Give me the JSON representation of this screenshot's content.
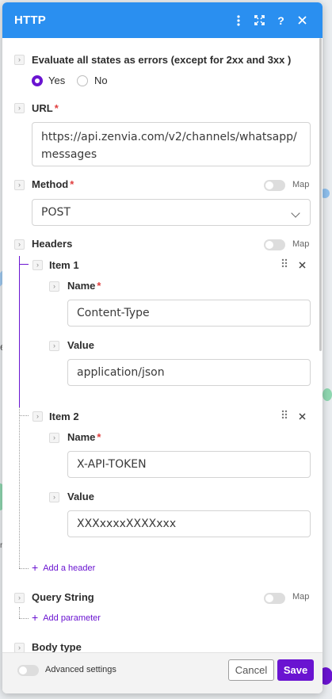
{
  "header": {
    "title": "HTTP"
  },
  "evaluate": {
    "label": "Evaluate all states as errors (except for 2xx and 3xx )",
    "yes_label": "Yes",
    "no_label": "No",
    "selected": "Yes"
  },
  "url": {
    "label": "URL",
    "required_mark": "*",
    "value": "https://api.zenvia.com/v2/channels/whatsapp/\nmessages"
  },
  "method": {
    "label": "Method",
    "required_mark": "*",
    "value": "POST",
    "map_label": "Map"
  },
  "headers": {
    "label": "Headers",
    "map_label": "Map",
    "items": [
      {
        "title": "Item 1",
        "name_label": "Name",
        "name_value": "Content-Type",
        "value_label": "Value",
        "value_value": "application/json"
      },
      {
        "title": "Item 2",
        "name_label": "Name",
        "name_value": "X-API-TOKEN",
        "value_label": "Value",
        "value_value": "XXXxxxxXXXXxxx"
      }
    ],
    "add_label": "Add a header"
  },
  "query_string": {
    "label": "Query String",
    "map_label": "Map",
    "add_label": "Add parameter"
  },
  "body_type": {
    "label": "Body type"
  },
  "footer": {
    "advanced_label": "Advanced settings",
    "cancel_label": "Cancel",
    "save_label": "Save"
  },
  "background": {
    "peek_text_1": "e",
    "peek_text_2": "r"
  },
  "colors": {
    "header": "#2a8ff0",
    "accent": "#6a14d1",
    "required": "#e03e3e"
  },
  "icons": {
    "header": [
      "kebab-icon",
      "expand-icon",
      "help-icon",
      "close-icon"
    ],
    "item": [
      "drag-handle-icon",
      "remove-icon"
    ]
  }
}
